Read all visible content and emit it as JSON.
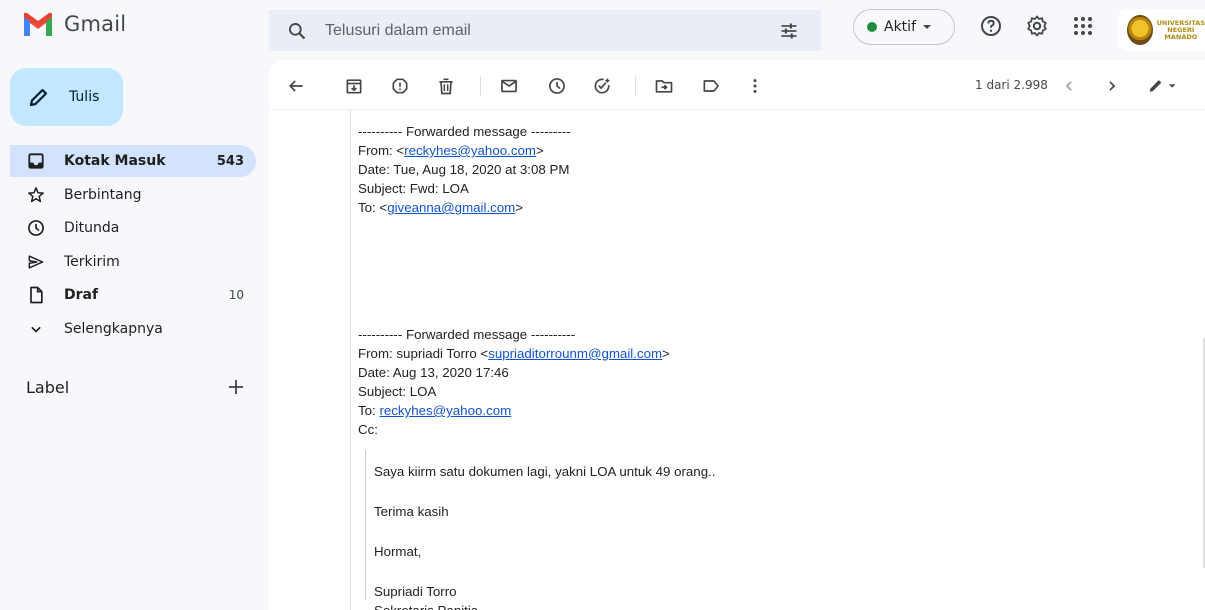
{
  "app": {
    "name": "Gmail"
  },
  "colors": {
    "accent": "#c2e7ff",
    "active_nav": "#d3e3fd",
    "link": "#1155cc",
    "status_green": "#1e8e3e",
    "logo_red": "#ea4335"
  },
  "search": {
    "placeholder": "Telusuri dalam email",
    "icon": "search-icon",
    "filter_icon": "tune-icon"
  },
  "status": {
    "label": "Aktif"
  },
  "header_icons": [
    "help-icon",
    "settings-icon",
    "apps-icon"
  ],
  "org": {
    "line1": "UNIVERSITAS",
    "line2": "NEGERI",
    "line3": "MANADO"
  },
  "compose": {
    "label": "Tulis"
  },
  "nav": [
    {
      "label": "Kotak Masuk",
      "count": "543",
      "icon": "inbox-icon"
    },
    {
      "label": "Berbintang",
      "count": "",
      "icon": "star-icon"
    },
    {
      "label": "Ditunda",
      "count": "",
      "icon": "clock-icon"
    },
    {
      "label": "Terkirim",
      "count": "",
      "icon": "send-icon"
    },
    {
      "label": "Draf",
      "count": "10",
      "icon": "draft-icon"
    },
    {
      "label": "Selengkapnya",
      "count": "",
      "icon": "chevron-down-icon"
    }
  ],
  "labels_header": "Label",
  "toolbar": {
    "icons": [
      "back-icon",
      "archive-icon",
      "report-spam-icon",
      "delete-icon",
      "mark-unread-icon",
      "snooze-icon",
      "add-task-icon",
      "move-to-icon",
      "label-icon",
      "more-icon"
    ],
    "pager": "1 dari 2.998"
  },
  "message": {
    "forward1": {
      "header": "---------- Forwarded message ---------",
      "from_prefix": "From: <",
      "from_email": "reckyhes@yahoo.com",
      "from_suffix": ">",
      "date": "Date: Tue, Aug 18, 2020 at 3:08 PM",
      "subject": "Subject: Fwd: LOA",
      "to_prefix": "To: <",
      "to_email": "giveanna@gmail.com",
      "to_suffix": ">"
    },
    "forward2": {
      "header": "---------- Forwarded message ----------",
      "from_prefix": "From: supriadi Torro <",
      "from_email": "supriaditorrounm@gmail.com",
      "from_suffix": ">",
      "date": "Date: Aug 13, 2020 17:46",
      "subject": "Subject: LOA",
      "to_prefix": "To: ",
      "to_email": "reckyhes@yahoo.com",
      "cc": "Cc:"
    },
    "body": {
      "line1": "Saya kiirm satu dokumen lagi, yakni LOA untuk 49 orang..",
      "line2": "Terima kasih",
      "line3": "Hormat,",
      "sig_name": "Supriadi Torro",
      "sig_title": "Sekretaris Panitia"
    }
  }
}
